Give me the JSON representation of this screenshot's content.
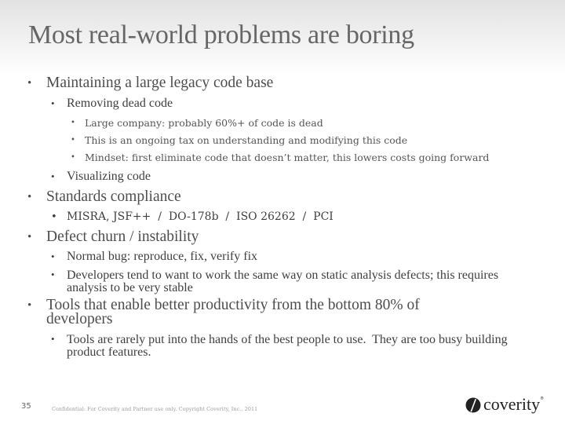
{
  "slide": {
    "title": "Most real-world problems are boring",
    "bullet_glyph": "•",
    "bullets": [
      {
        "text": "Maintaining a large legacy code base",
        "children": [
          {
            "text": "Removing dead code",
            "children": [
              {
                "text": "Large company: probably 60%+ of code is dead"
              },
              {
                "text": "This is an ongoing tax on understanding and modifying this code"
              },
              {
                "text": "Mindset: first eliminate code that doesn’t matter, this lowers costs going forward"
              }
            ]
          },
          {
            "text": "Visualizing code"
          }
        ]
      },
      {
        "text": "Standards compliance",
        "children": [
          {
            "text": "MISRA, JSF++  /  DO-178b  /  ISO 26262  /  PCI"
          }
        ]
      },
      {
        "text": "Defect churn / instability",
        "children": [
          {
            "text": "Normal bug: reproduce, fix, verify fix"
          },
          {
            "text": "Developers tend to want to work the same way on static analysis defects; this requires analysis to be very stable"
          }
        ]
      },
      {
        "text": "Tools that enable better productivity from the bottom 80% of developers",
        "children": [
          {
            "text": "Tools are rarely put into the hands of the best people to use.  They are too busy building product features."
          }
        ]
      }
    ]
  },
  "footer": {
    "slide_number": "35",
    "confidential": "Confidential: For Coverity and Partner use only. Copyright Coverity, Inc., 2011",
    "logo_text": "coverity",
    "logo_tm": "®",
    "logo_icon": "coverity-logo-icon"
  }
}
